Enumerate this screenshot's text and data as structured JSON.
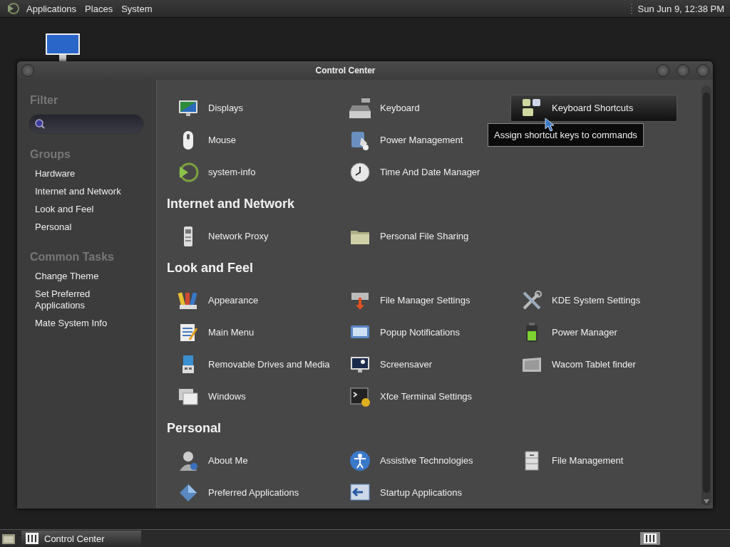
{
  "top_panel": {
    "menus": [
      "Applications",
      "Places",
      "System"
    ],
    "clock": "Sun Jun  9, 12:38 PM"
  },
  "window": {
    "title": "Control Center",
    "sidebar": {
      "filter_heading": "Filter",
      "groups_heading": "Groups",
      "groups": [
        "Hardware",
        "Internet and Network",
        "Look and Feel",
        "Personal"
      ],
      "tasks_heading": "Common Tasks",
      "tasks": [
        "Change Theme",
        "Set Preferred Applications",
        "Mate System Info"
      ]
    },
    "sections": [
      {
        "rows": [
          [
            {
              "label": "Displays",
              "selected": false
            },
            {
              "label": "Keyboard",
              "selected": false
            },
            {
              "label": "Keyboard Shortcuts",
              "selected": true
            }
          ],
          [
            {
              "label": "Mouse",
              "selected": false
            },
            {
              "label": "Power Management",
              "selected": false
            }
          ],
          [
            {
              "label": "system-info",
              "selected": false
            },
            {
              "label": "Time And Date Manager",
              "selected": false
            }
          ]
        ]
      },
      {
        "title": "Internet and Network",
        "items": [
          {
            "label": "Network Proxy",
            "selected": false
          },
          {
            "label": "Personal File Sharing",
            "selected": false
          }
        ]
      },
      {
        "title": "Look and Feel",
        "items": [
          {
            "label": "Appearance",
            "selected": false
          },
          {
            "label": "File Manager Settings",
            "selected": false
          },
          {
            "label": "KDE System Settings",
            "selected": false
          },
          {
            "label": "Main Menu",
            "selected": false
          },
          {
            "label": "Popup Notifications",
            "selected": false
          },
          {
            "label": "Power Manager",
            "selected": false
          },
          {
            "label": "Removable Drives and Media",
            "selected": false
          },
          {
            "label": "Screensaver",
            "selected": false
          },
          {
            "label": "Wacom Tablet finder",
            "selected": false
          },
          {
            "label": "Windows",
            "selected": false
          },
          {
            "label": "Xfce Terminal Settings",
            "selected": false
          }
        ]
      },
      {
        "title": "Personal",
        "items": [
          {
            "label": "About Me",
            "selected": false
          },
          {
            "label": "Assistive Technologies",
            "selected": false
          },
          {
            "label": "File Management",
            "selected": false
          },
          {
            "label": "Preferred Applications",
            "selected": false
          },
          {
            "label": "Startup Applications",
            "selected": false
          }
        ]
      }
    ],
    "tooltip": "Assign shortcut keys to commands"
  },
  "taskbar": {
    "tasks": [
      {
        "label": "Control Center",
        "selected": true
      }
    ]
  }
}
